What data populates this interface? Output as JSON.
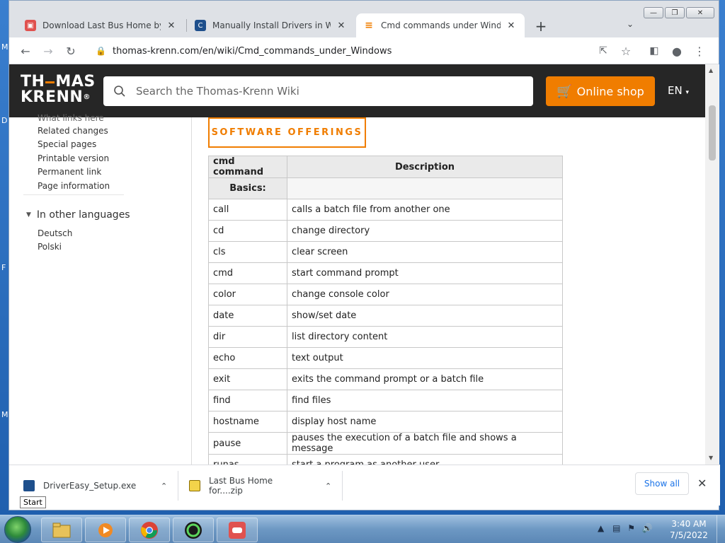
{
  "browser": {
    "tabs": [
      {
        "title": "Download Last Bus Home by maj",
        "favicon": "game-icon",
        "active": false
      },
      {
        "title": "Manually Install Drivers in Windo",
        "favicon": "drivereasy-icon",
        "active": false
      },
      {
        "title": "Cmd commands under Windows",
        "favicon": "thomas-krenn-icon",
        "active": true
      }
    ],
    "url": "thomas-krenn.com/en/wiki/Cmd_commands_under_Windows"
  },
  "site": {
    "logo_line1": "TH",
    "logo_line1b": "MAS",
    "logo_line2": "KRENN",
    "logo_reg": "®",
    "search_placeholder": "Search the Thomas-Krenn Wiki",
    "shop_label": "Online shop",
    "lang_label": "EN",
    "software_button": "SOFTWARE OFFERINGS"
  },
  "sidebar": {
    "cut_link": "What links here",
    "tools": [
      "Related changes",
      "Special pages",
      "Printable version",
      "Permanent link",
      "Page information"
    ],
    "languages_heading": "In other languages",
    "languages": [
      "Deutsch",
      "Polski"
    ]
  },
  "table": {
    "headers": [
      "cmd command",
      "Description"
    ],
    "section": "Basics:",
    "rows": [
      [
        "call",
        "calls a batch file from another one"
      ],
      [
        "cd",
        "change directory"
      ],
      [
        "cls",
        "clear screen"
      ],
      [
        "cmd",
        "start command prompt"
      ],
      [
        "color",
        "change console color"
      ],
      [
        "date",
        "show/set date"
      ],
      [
        "dir",
        "list directory content"
      ],
      [
        "echo",
        "text output"
      ],
      [
        "exit",
        "exits the command prompt or a batch file"
      ],
      [
        "find",
        "find files"
      ],
      [
        "hostname",
        "display host name"
      ],
      [
        "pause",
        "pauses the execution of a batch file and shows a message"
      ],
      [
        "runas",
        "start a program as another user"
      ]
    ]
  },
  "downloads": {
    "items": [
      "DriverEasy_Setup.exe",
      "Last Bus Home for....zip"
    ],
    "show_all": "Show all"
  },
  "taskbar": {
    "start_tooltip": "Start",
    "time": "3:40 AM",
    "date": "7/5/2022"
  },
  "colors": {
    "accent": "#f07d00",
    "header_bg": "#262626"
  }
}
